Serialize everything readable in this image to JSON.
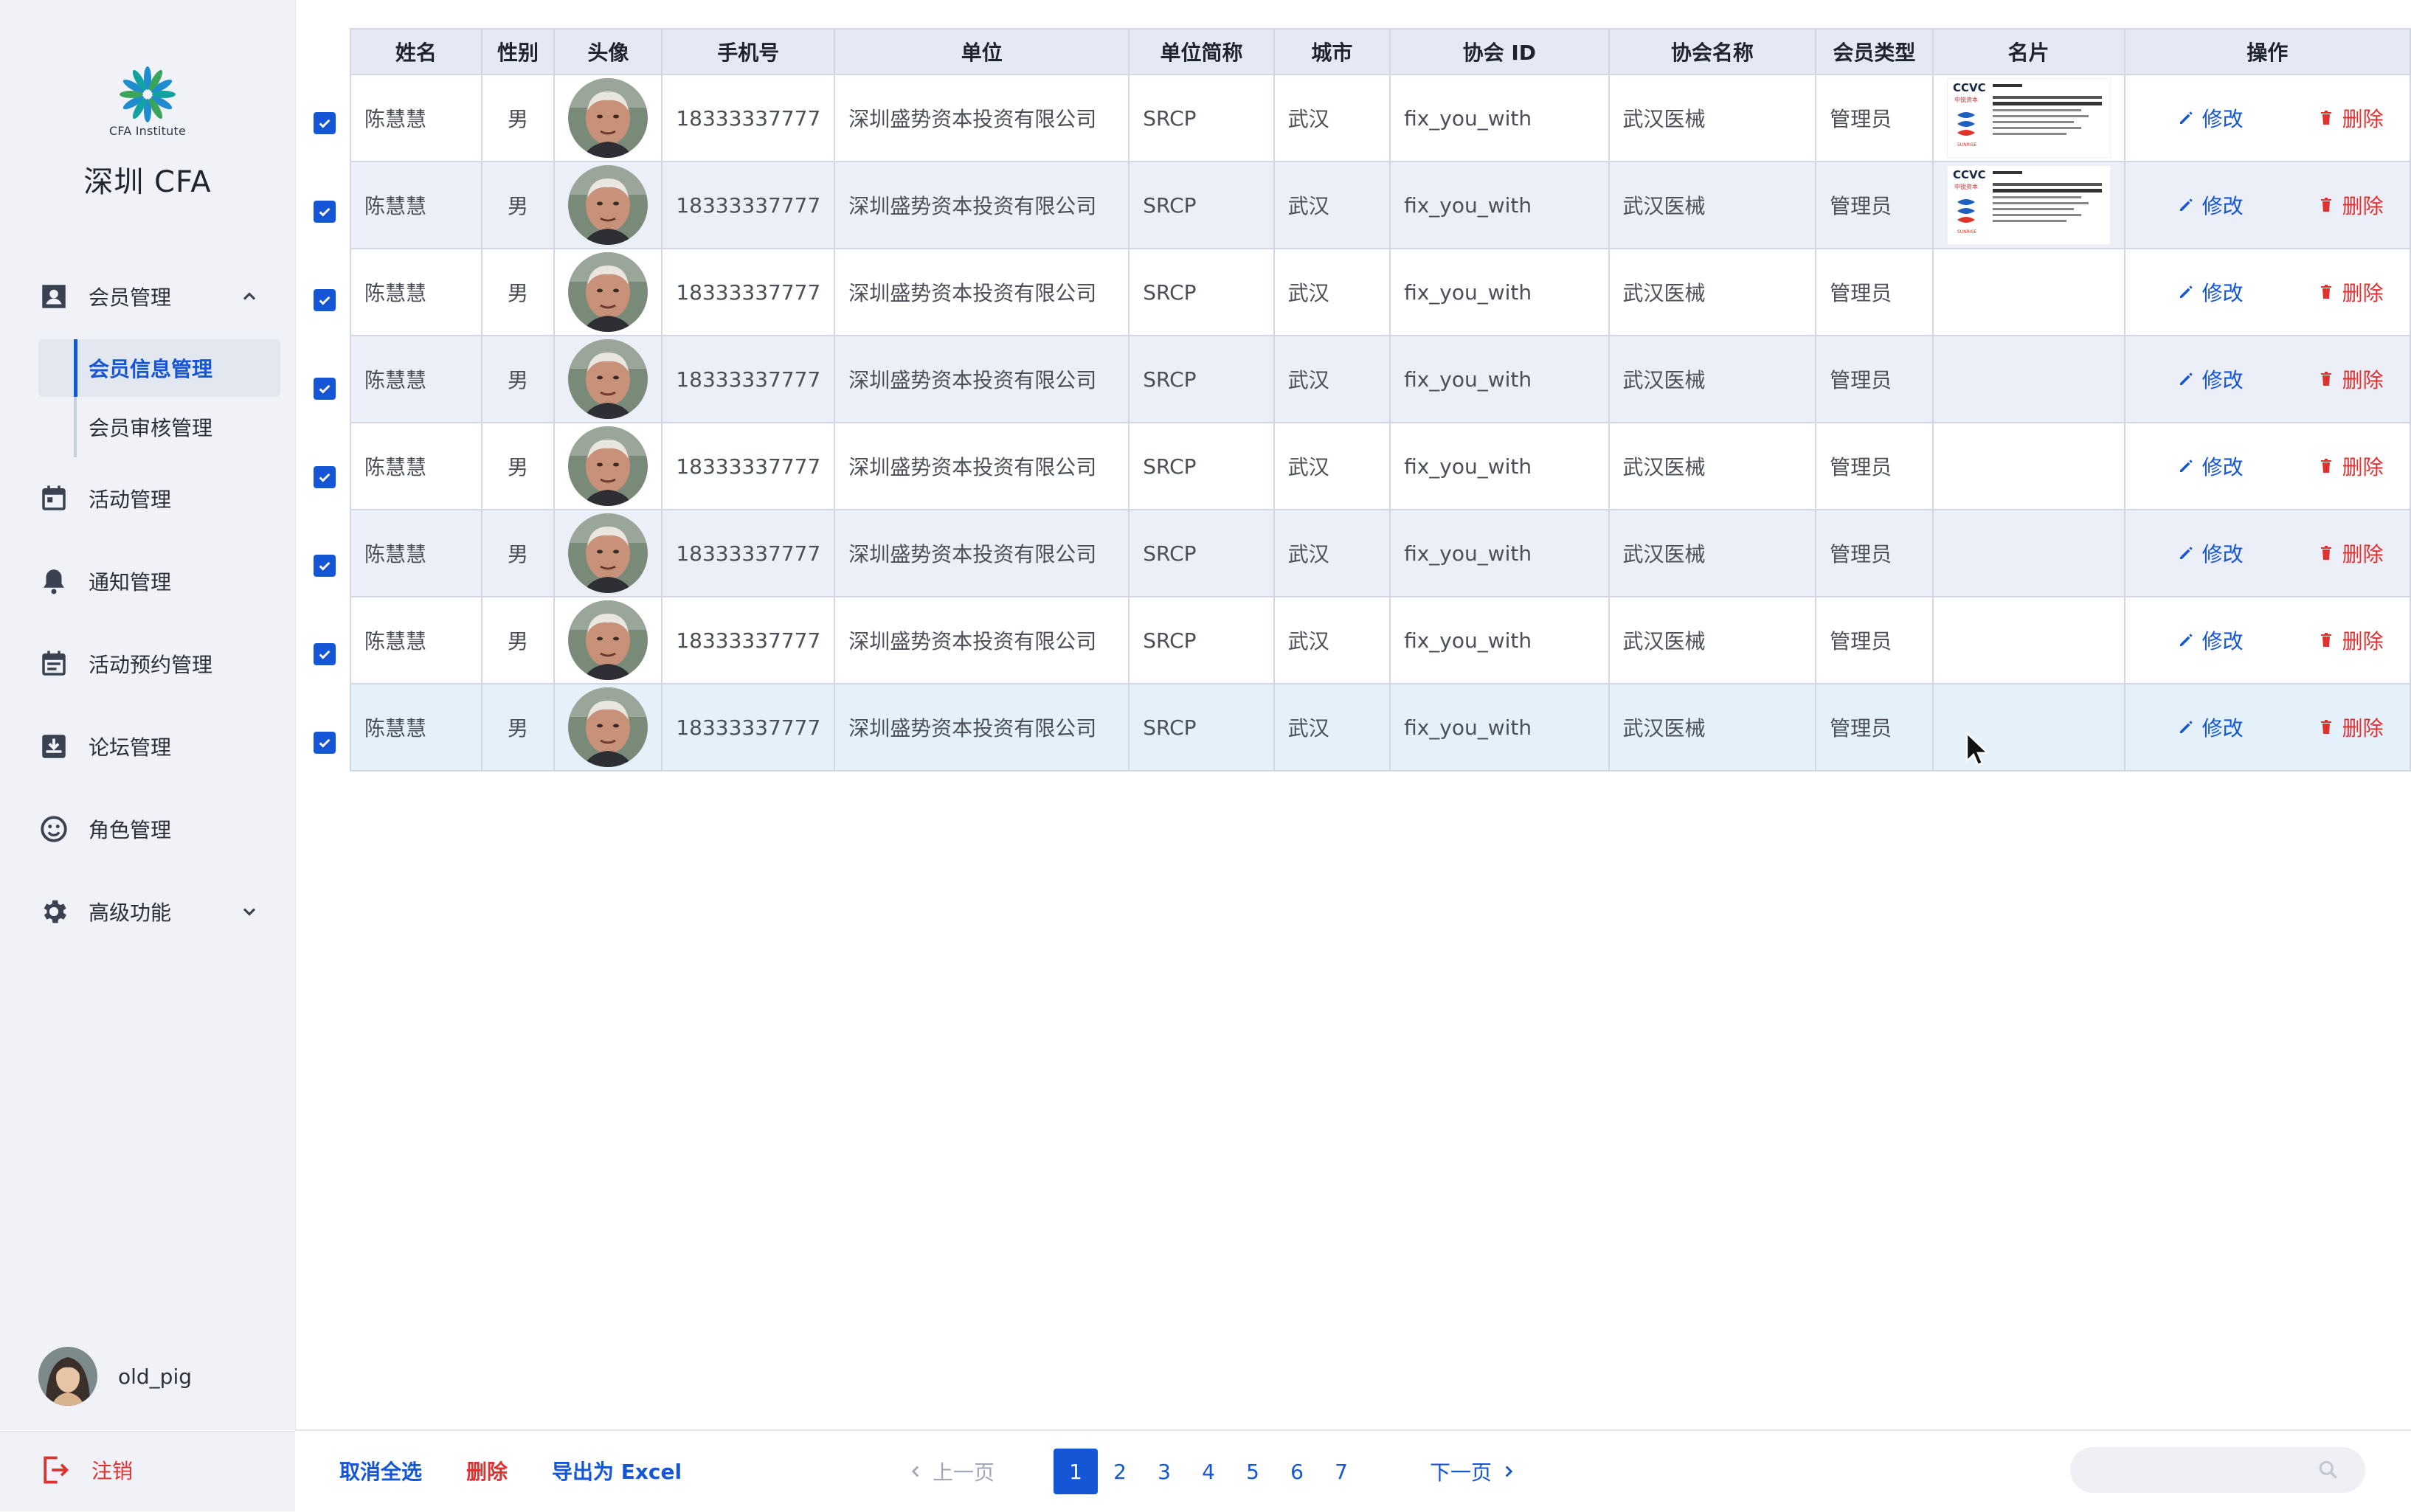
{
  "sidebar": {
    "logo_text": "CFA Institute",
    "brand": "深圳 CFA",
    "nav": {
      "member": "会员管理",
      "member_info": "会员信息管理",
      "member_review": "会员审核管理",
      "activity": "活动管理",
      "notice": "通知管理",
      "booking": "活动预约管理",
      "forum": "论坛管理",
      "role": "角色管理",
      "advanced": "高级功能"
    },
    "username": "old_pig",
    "logout": "注销"
  },
  "table": {
    "headers": [
      "姓名",
      "性别",
      "头像",
      "手机号",
      "单位",
      "单位简称",
      "城市",
      "协会 ID",
      "协会名称",
      "会员类型",
      "名片",
      "操作"
    ],
    "rows": [
      {
        "name": "陈慧慧",
        "gender": "男",
        "phone": "18333337777",
        "company": "深圳盛势资本投资有限公司",
        "abbr": "SRCP",
        "city": "武汉",
        "assoc_id": "fix_you_with",
        "assoc_name": "武汉医械",
        "type": "管理员",
        "has_card": true
      },
      {
        "name": "陈慧慧",
        "gender": "男",
        "phone": "18333337777",
        "company": "深圳盛势资本投资有限公司",
        "abbr": "SRCP",
        "city": "武汉",
        "assoc_id": "fix_you_with",
        "assoc_name": "武汉医械",
        "type": "管理员",
        "has_card": true
      },
      {
        "name": "陈慧慧",
        "gender": "男",
        "phone": "18333337777",
        "company": "深圳盛势资本投资有限公司",
        "abbr": "SRCP",
        "city": "武汉",
        "assoc_id": "fix_you_with",
        "assoc_name": "武汉医械",
        "type": "管理员",
        "has_card": false
      },
      {
        "name": "陈慧慧",
        "gender": "男",
        "phone": "18333337777",
        "company": "深圳盛势资本投资有限公司",
        "abbr": "SRCP",
        "city": "武汉",
        "assoc_id": "fix_you_with",
        "assoc_name": "武汉医械",
        "type": "管理员",
        "has_card": false
      },
      {
        "name": "陈慧慧",
        "gender": "男",
        "phone": "18333337777",
        "company": "深圳盛势资本投资有限公司",
        "abbr": "SRCP",
        "city": "武汉",
        "assoc_id": "fix_you_with",
        "assoc_name": "武汉医械",
        "type": "管理员",
        "has_card": false
      },
      {
        "name": "陈慧慧",
        "gender": "男",
        "phone": "18333337777",
        "company": "深圳盛势资本投资有限公司",
        "abbr": "SRCP",
        "city": "武汉",
        "assoc_id": "fix_you_with",
        "assoc_name": "武汉医械",
        "type": "管理员",
        "has_card": false
      },
      {
        "name": "陈慧慧",
        "gender": "男",
        "phone": "18333337777",
        "company": "深圳盛势资本投资有限公司",
        "abbr": "SRCP",
        "city": "武汉",
        "assoc_id": "fix_you_with",
        "assoc_name": "武汉医械",
        "type": "管理员",
        "has_card": false
      },
      {
        "name": "陈慧慧",
        "gender": "男",
        "phone": "18333337777",
        "company": "深圳盛势资本投资有限公司",
        "abbr": "SRCP",
        "city": "武汉",
        "assoc_id": "fix_you_with",
        "assoc_name": "武汉医械",
        "type": "管理员",
        "has_card": false
      }
    ],
    "edit_label": "修改",
    "delete_label": "删除"
  },
  "bottom": {
    "deselect_all": "取消全选",
    "delete": "删除",
    "export": "导出为 Excel",
    "prev": "上一页",
    "next": "下一页",
    "pages": [
      "1",
      "2",
      "3",
      "4",
      "5",
      "6",
      "7"
    ],
    "current_page": "1"
  },
  "colors": {
    "accent": "#1456d6",
    "danger": "#e03131",
    "sidebar_bg": "#f0f2f8",
    "row_alt": "#eceff7",
    "row_hover": "#e4f1fb"
  }
}
